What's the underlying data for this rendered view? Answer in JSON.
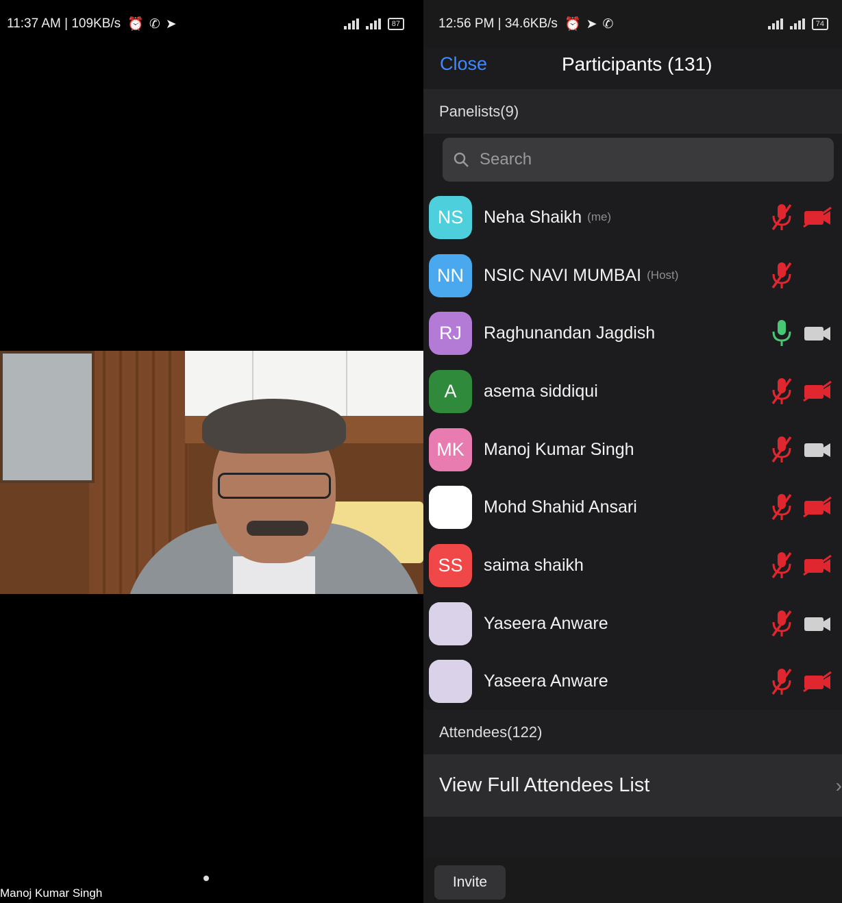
{
  "left_status": {
    "time": "11:37 AM | 109KB/s",
    "battery": "87"
  },
  "right_status": {
    "time": "12:56 PM | 34.6KB/s",
    "battery": "74"
  },
  "video": {
    "speaker_name": "Manoj Kumar Singh"
  },
  "participants_panel": {
    "close_label": "Close",
    "title": "Participants (131)",
    "panelists_header": "Panelists(9)",
    "search_placeholder": "Search",
    "panelists": [
      {
        "initials": "NS",
        "name": "Neha Shaikh",
        "tag": "(me)",
        "avatar_color": "#4dd0dc",
        "mic": "muted",
        "video": "off"
      },
      {
        "initials": "NN",
        "name": "NSIC NAVI MUMBAI",
        "tag": "(Host)",
        "avatar_color": "#4aa8ef",
        "mic": "muted",
        "video": "none"
      },
      {
        "initials": "RJ",
        "name": "Raghunandan Jagdish",
        "tag": "",
        "avatar_color": "#b47bd6",
        "mic": "on",
        "video": "on"
      },
      {
        "initials": "A",
        "name": "asema siddiqui",
        "tag": "",
        "avatar_color": "#2f8a3b",
        "mic": "muted",
        "video": "off"
      },
      {
        "initials": "MK",
        "name": "Manoj Kumar Singh",
        "tag": "",
        "avatar_color": "#e87bb0",
        "mic": "muted",
        "video": "on"
      },
      {
        "initials": "",
        "name": "Mohd Shahid Ansari",
        "tag": "",
        "avatar_color": "#ffffff",
        "mic": "muted",
        "video": "off"
      },
      {
        "initials": "SS",
        "name": "saima shaikh",
        "tag": "",
        "avatar_color": "#f04848",
        "mic": "muted",
        "video": "off"
      },
      {
        "initials": "",
        "name": "Yaseera Anware",
        "tag": "",
        "avatar_color": "#d9d2e8",
        "mic": "muted",
        "video": "on"
      },
      {
        "initials": "",
        "name": "Yaseera Anware",
        "tag": "",
        "avatar_color": "#d9d2e8",
        "mic": "muted",
        "video": "off"
      }
    ],
    "attendees_header": "Attendees(122)",
    "view_full_label": "View Full Attendees List",
    "invite_label": "Invite"
  },
  "colors": {
    "accent_link": "#3d8bff",
    "muted_red": "#e0272f",
    "mic_on_green": "#48c774",
    "panel_bg": "#1c1c1e"
  },
  "icons": [
    "alarm-icon",
    "whatsapp-icon",
    "telegram-icon",
    "signal-icon",
    "battery-icon",
    "search-icon",
    "mic-muted-icon",
    "mic-on-icon",
    "video-off-icon",
    "video-on-icon",
    "chevron-right-icon"
  ]
}
